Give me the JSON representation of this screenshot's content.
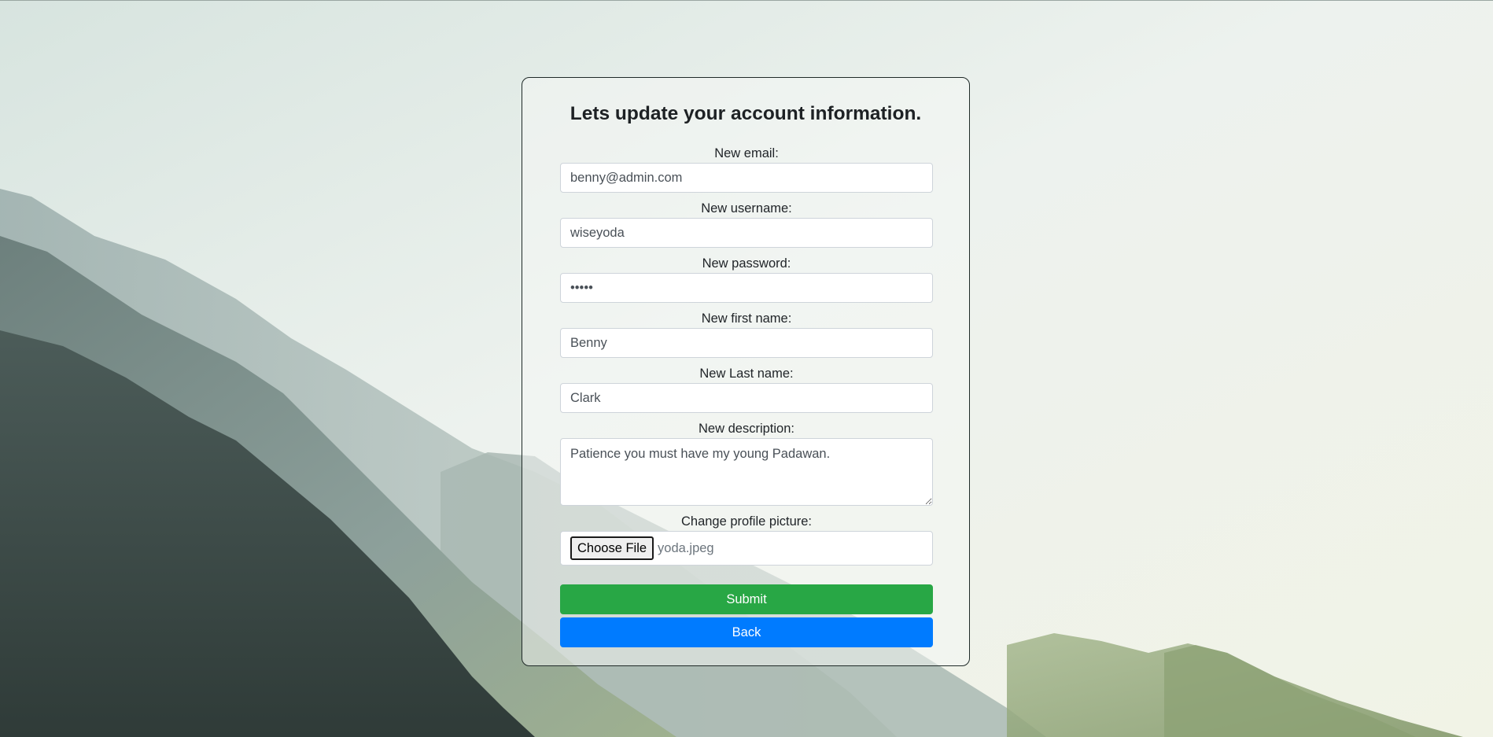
{
  "form": {
    "title": "Lets update your account information.",
    "email": {
      "label": "New email:",
      "value": "benny@admin.com"
    },
    "username": {
      "label": "New username:",
      "value": "wiseyoda"
    },
    "password": {
      "label": "New password:",
      "value": "•••••"
    },
    "first_name": {
      "label": "New first name:",
      "value": "Benny"
    },
    "last_name": {
      "label": "New Last name:",
      "value": "Clark"
    },
    "description": {
      "label": "New description:",
      "value": "Patience you must have my young Padawan."
    },
    "picture": {
      "label": "Change profile picture:",
      "button_label": "Choose File",
      "file_name": "yoda.jpeg"
    },
    "submit_label": "Submit",
    "back_label": "Back"
  },
  "colors": {
    "submit": "#28a745",
    "back": "#007bff",
    "card_border": "#1f2a28"
  }
}
